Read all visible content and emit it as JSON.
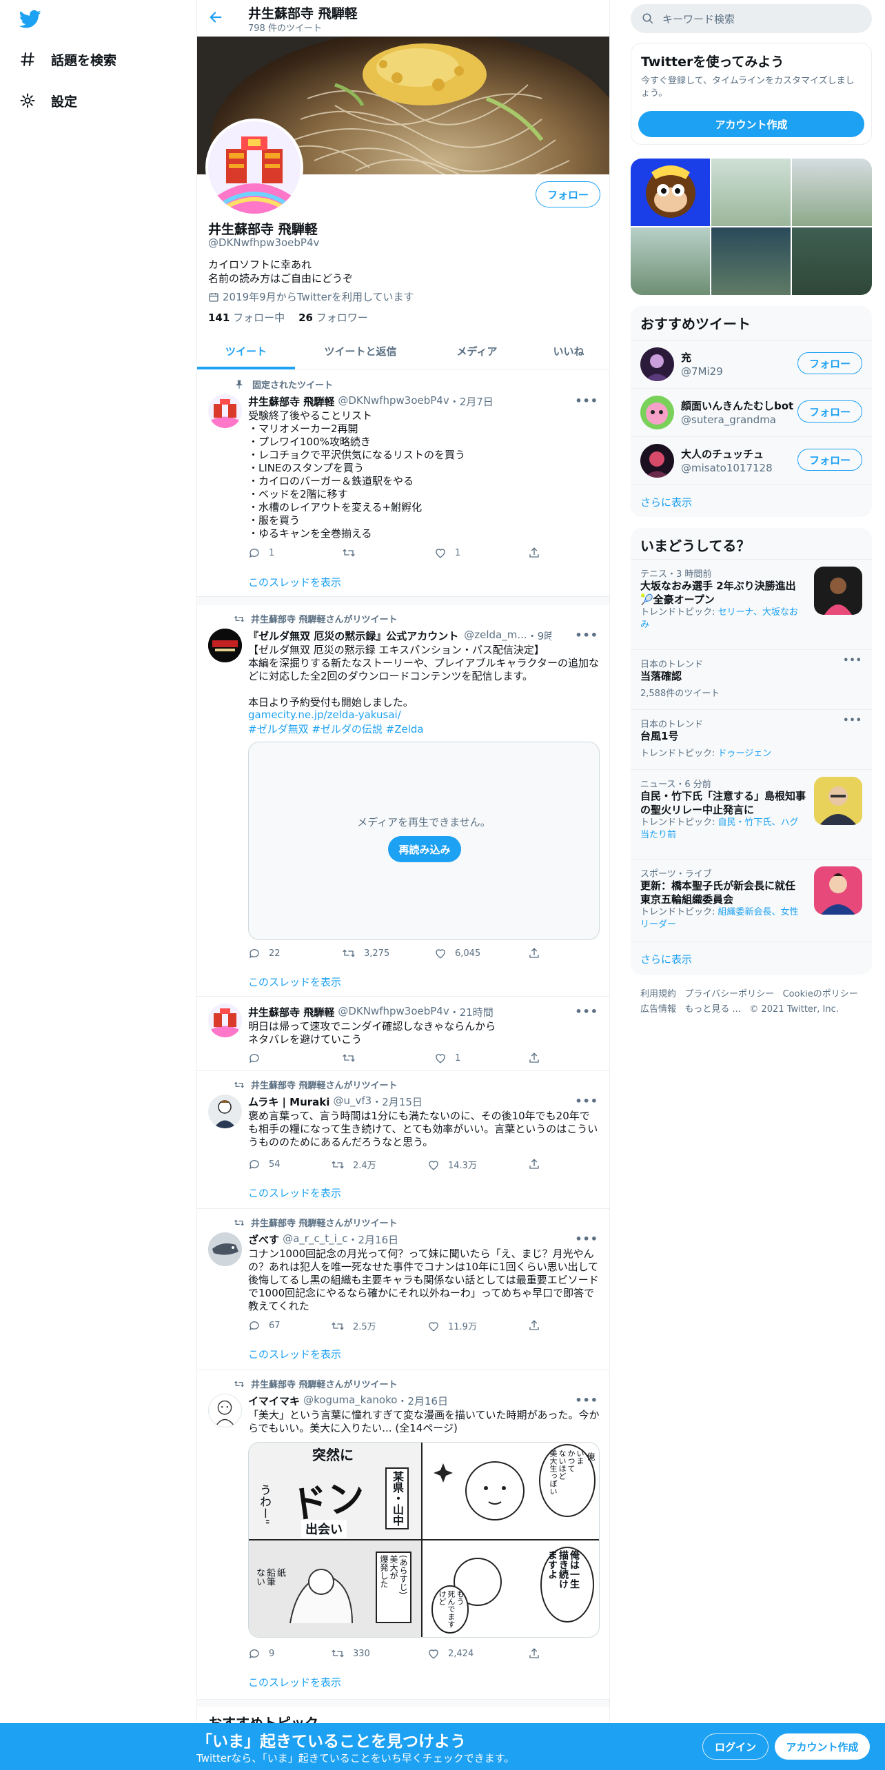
{
  "nav": {
    "explore": "話題を検索",
    "settings": "設定"
  },
  "header": {
    "name": "井生蘇部寺 飛騨軽",
    "count": "798 件のツイート"
  },
  "profile": {
    "name": "井生蘇部寺 飛騨軽",
    "handle": "@DKNwfhpw3oebP4v",
    "bio1": "カイロソフトに幸あれ",
    "bio2": "名前の読み方はご自由にどうぞ",
    "joined": "2019年9月からTwitterを利用しています",
    "following_count": "141",
    "following_label": "フォロー中",
    "followers_count": "26",
    "followers_label": "フォロワー",
    "follow_button": "フォロー"
  },
  "tabs": [
    "ツイート",
    "ツイートと返信",
    "メディア",
    "いいね"
  ],
  "tweets": {
    "t1": {
      "pinned": "固定されたツイート",
      "name": "井生蘇部寺 飛騨軽",
      "handle": "@DKNwfhpw3oebP4v",
      "date": "・2月7日",
      "text": "受験終了後やることリスト\n・マリオメーカー2再開\n・プレワイ100%攻略続き\n・レコチョクで平沢供気になるリストのを買う\n・LINEのスタンプを買う\n・カイロのバーガー＆鉄道駅をやる\n・ベッドを2階に移す\n・水槽のレイアウトを変える+鮒孵化\n・服を買う\n・ゆるキャンを全巻揃える",
      "reply": "1",
      "retweet": "",
      "like": "1",
      "thread": "このスレッドを表示"
    },
    "t2": {
      "rt_by": "井生蘇部寺 飛騨軽さんがリツイート",
      "name": "『ゼルダ無双 厄災の黙示録』公式アカウント",
      "handle": "@zelda_m...",
      "date": "・9時間",
      "text": "【ゼルダ無双 厄災の黙示録 エキスパンション・パス配信決定】\n本編を深掘りする新たなストーリーや、プレイアブルキャラクターの追加などに対応した全2回のダウンロードコンテンツを配信します。\n\n本日より予約受付も開始しました。",
      "link": "gamecity.ne.jp/zelda-yakusai/",
      "tags": "#ゼルダ無双 #ゼルダの伝説 #Zelda",
      "media_msg": "メディアを再生できません。",
      "reload": "再読み込み",
      "reply": "22",
      "retweet": "3,275",
      "like": "6,045",
      "thread": "このスレッドを表示"
    },
    "t3": {
      "name": "井生蘇部寺 飛騨軽",
      "handle": "@DKNwfhpw3oebP4v",
      "date": "・21時間",
      "text": "明日は帰って速攻でニンダイ確認しなきゃならんから\nネタバレを避けていこう",
      "reply": "",
      "retweet": "",
      "like": "1"
    },
    "t4": {
      "rt_by": "井生蘇部寺 飛騨軽さんがリツイート",
      "name": "ムラキ | Muraki",
      "handle": "@u_vf3",
      "date": "・2月15日",
      "text": "褒め言葉って、言う時間は1分にも満たないのに、その後10年でも20年でも相手の糧になって生き続けて、とても効率がいい。言葉というのはこういうもののためにあるんだろうなと思う。",
      "reply": "54",
      "retweet": "2.4万",
      "like": "14.3万",
      "thread": "このスレッドを表示"
    },
    "t5": {
      "rt_by": "井生蘇部寺 飛騨軽さんがリツイート",
      "name": "ざべす",
      "handle": "@a_r_c_t_i_c",
      "date": "・2月16日",
      "text": "コナン1000回記念の月光って何？って妹に聞いたら「え、まじ？月光やんの？あれは犯人を唯一死なせた事件でコナンは10年に1回くらい思い出して後悔してるし黒の組織も主要キャラも関係ない話としては最重要エピソードで1000回記念にやるなら確かにそれ以外ねーわ」ってめちゃ早口で即答で教えてくれた",
      "reply": "67",
      "retweet": "2.5万",
      "like": "11.9万",
      "thread": "このスレッドを表示"
    },
    "t6": {
      "rt_by": "井生蘇部寺 飛騨軽さんがリツイート",
      "name": "イマイマキ",
      "handle": "@koguma_kanoko",
      "date": "・2月16日",
      "text": "「美大」という言葉に憧れすぎて変な漫画を描いていた時期があった。今からでもいい。美大に入りたい... (全14ページ)",
      "manga": {
        "p1a": "突然に",
        "p1b": "ドン",
        "p1c": "うわー\"",
        "p1d": "某県・山中",
        "p1e": "出会い",
        "p2a": "いま\nかつて\nないほど\n美大生っぽい",
        "p2b": "俺",
        "p3a": "紙\n鉛筆\nない",
        "p3b": "(あらすじ)\n美大が\n爆発した",
        "p4a": "俺は一生\n描き続け\nますよ",
        "p4b": "もう\n死んでます\nけど"
      },
      "reply": "9",
      "retweet": "330",
      "like": "2,424",
      "thread": "このスレッドを表示"
    }
  },
  "recommended_topics_heading": "おすすめトピック",
  "search": {
    "placeholder": "キーワード検索"
  },
  "signup": {
    "title": "Twitterを使ってみよう",
    "desc": "今すぐ登録して、タイムラインをカスタマイズしましょう。",
    "button": "アカウント作成"
  },
  "who_to_follow": {
    "title": "おすすめツイート",
    "users": [
      {
        "name": "充",
        "handle": "@7Mi29",
        "button": "フォロー"
      },
      {
        "name": "顔面いんきんたむしbot",
        "handle": "@sutera_grandma",
        "button": "フォロー"
      },
      {
        "name": "大人のチュッチュ",
        "handle": "@misato1017128",
        "button": "フォロー"
      }
    ],
    "more": "さらに表示"
  },
  "trends": {
    "title": "いまどうしてる？",
    "items": [
      {
        "meta": "テニス・3 時間前",
        "title": "大坂なおみ選手 2年ぶり決勝進出🎾全豪オープン",
        "sub_label": "トレンドトピック: ",
        "sub_links": "セリーナ、大坂なおみ"
      },
      {
        "meta": "日本のトレンド",
        "title": "当落確認",
        "sub_label": "2,588件のツイート",
        "sub_links": ""
      },
      {
        "meta": "日本のトレンド",
        "title": "台風1号",
        "sub_label": "トレンドトピック: ",
        "sub_links": "ドゥージェン"
      },
      {
        "meta": "ニュース・6 分前",
        "title": "自民・竹下氏「注意する」島根知事の聖火リレー中止発言に",
        "sub_label": "トレンドトピック: ",
        "sub_links": "自民・竹下氏、ハグ当たり前"
      },
      {
        "meta": "スポーツ・ライブ",
        "title": "更新：橋本聖子氏が新会長に就任 東京五輪組織委員会",
        "sub_label": "トレンドトピック: ",
        "sub_links": "組織委新会長、女性リーダー"
      }
    ],
    "more": "さらに表示"
  },
  "footer": {
    "l1": "利用規約",
    "l2": "プライバシーポリシー",
    "l3": "Cookieのポリシー",
    "l4": "広告情報",
    "l5": "もっと見る ...",
    "copy": "© 2021 Twitter, Inc."
  },
  "bottom": {
    "title": "「いま」起きていることを見つけよう",
    "sub": "Twitterなら、「いま」起きていることをいち早くチェックできます。",
    "login": "ログイン",
    "signup": "アカウント作成"
  },
  "colors": {
    "accent": "#1da1f2",
    "text": "#0f1419",
    "muted": "#5b7083"
  }
}
